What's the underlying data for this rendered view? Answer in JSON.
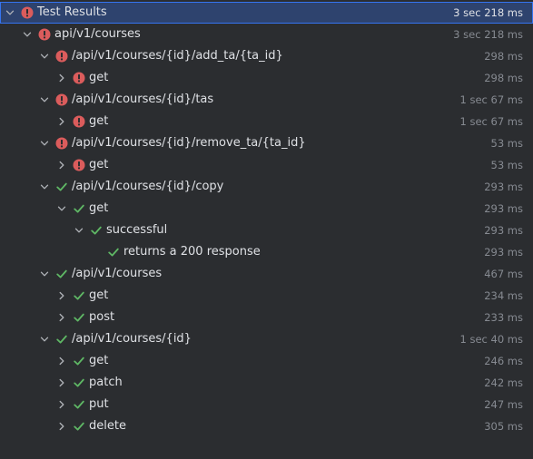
{
  "colors": {
    "background": "#2b2d30",
    "selection": "#2e436e",
    "error": "#db5c5c",
    "success": "#5fb865",
    "text": "#dfe1e5",
    "muted": "#868a91"
  },
  "rows": [
    {
      "label": "Test Results",
      "time": "3 sec 218 ms",
      "status": "error",
      "level": 0,
      "toggle": "expanded"
    },
    {
      "label": "api/v1/courses",
      "time": "3 sec 218 ms",
      "status": "error",
      "level": 1,
      "toggle": "expanded"
    },
    {
      "label": "/api/v1/courses/{id}/add_ta/{ta_id}",
      "time": "298 ms",
      "status": "error",
      "level": 2,
      "toggle": "expanded"
    },
    {
      "label": "get",
      "time": "298 ms",
      "status": "error",
      "level": 3,
      "toggle": "collapsed"
    },
    {
      "label": "/api/v1/courses/{id}/tas",
      "time": "1 sec 67 ms",
      "status": "error",
      "level": 2,
      "toggle": "expanded"
    },
    {
      "label": "get",
      "time": "1 sec 67 ms",
      "status": "error",
      "level": 3,
      "toggle": "collapsed"
    },
    {
      "label": "/api/v1/courses/{id}/remove_ta/{ta_id}",
      "time": "53 ms",
      "status": "error",
      "level": 2,
      "toggle": "expanded"
    },
    {
      "label": "get",
      "time": "53 ms",
      "status": "error",
      "level": 3,
      "toggle": "collapsed"
    },
    {
      "label": "/api/v1/courses/{id}/copy",
      "time": "293 ms",
      "status": "success",
      "level": 2,
      "toggle": "expanded"
    },
    {
      "label": "get",
      "time": "293 ms",
      "status": "success",
      "level": 3,
      "toggle": "expanded"
    },
    {
      "label": "successful",
      "time": "293 ms",
      "status": "success",
      "level": 4,
      "toggle": "expanded"
    },
    {
      "label": "returns a 200 response",
      "time": "293 ms",
      "status": "success",
      "level": 5,
      "toggle": "none"
    },
    {
      "label": "/api/v1/courses",
      "time": "467 ms",
      "status": "success",
      "level": 2,
      "toggle": "expanded"
    },
    {
      "label": "get",
      "time": "234 ms",
      "status": "success",
      "level": 3,
      "toggle": "collapsed"
    },
    {
      "label": "post",
      "time": "233 ms",
      "status": "success",
      "level": 3,
      "toggle": "collapsed"
    },
    {
      "label": "/api/v1/courses/{id}",
      "time": "1 sec 40 ms",
      "status": "success",
      "level": 2,
      "toggle": "expanded"
    },
    {
      "label": "get",
      "time": "246 ms",
      "status": "success",
      "level": 3,
      "toggle": "collapsed"
    },
    {
      "label": "patch",
      "time": "242 ms",
      "status": "success",
      "level": 3,
      "toggle": "collapsed"
    },
    {
      "label": "put",
      "time": "247 ms",
      "status": "success",
      "level": 3,
      "toggle": "collapsed"
    },
    {
      "label": "delete",
      "time": "305 ms",
      "status": "success",
      "level": 3,
      "toggle": "collapsed"
    }
  ]
}
